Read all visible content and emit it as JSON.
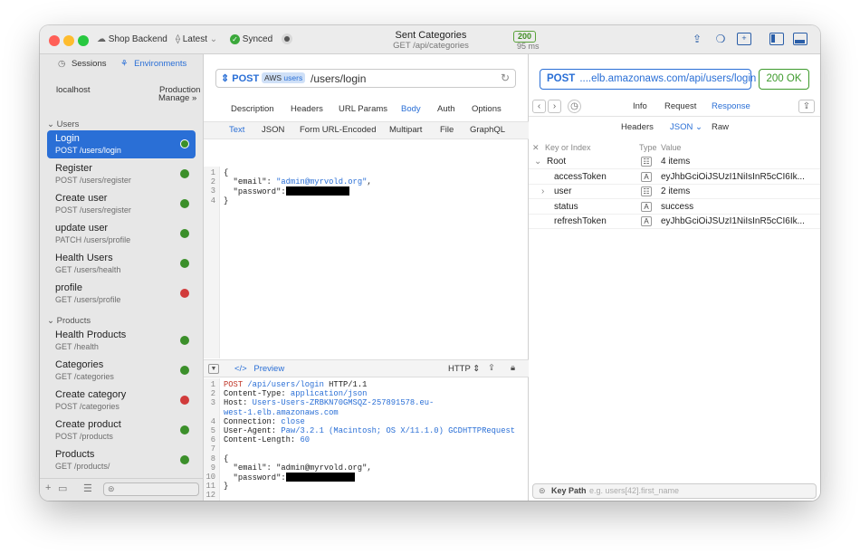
{
  "toolbar": {
    "project": "Shop Backend",
    "version": "Latest",
    "sync": "Synced",
    "title": "Sent Categories",
    "subtitle": "GET /api/categories",
    "status": "200",
    "time": "95 ms"
  },
  "sidebar": {
    "tabs": [
      "Sessions",
      "Environments"
    ],
    "env_left": "localhost",
    "env_right": "Production",
    "manage": "Manage",
    "groups": [
      {
        "label": "Users",
        "items": [
          {
            "name": "Login",
            "sub": "POST /users/login",
            "status": "green"
          },
          {
            "name": "Register",
            "sub": "POST /users/register",
            "status": "green"
          },
          {
            "name": "Create user",
            "sub": "POST /users/register",
            "status": "green"
          },
          {
            "name": "update user",
            "sub": "PATCH /users/profile",
            "status": "green"
          },
          {
            "name": "Health Users",
            "sub": "GET /users/health",
            "status": "green"
          },
          {
            "name": "profile",
            "sub": "GET /users/profile",
            "status": "red"
          }
        ]
      },
      {
        "label": "Products",
        "items": [
          {
            "name": "Health Products",
            "sub": "GET /health",
            "status": "green"
          },
          {
            "name": "Categories",
            "sub": "GET /categories",
            "status": "green"
          },
          {
            "name": "Create category",
            "sub": "POST /categories",
            "status": "red"
          },
          {
            "name": "Create product",
            "sub": "POST /products",
            "status": "green"
          },
          {
            "name": "Products",
            "sub": "GET /products/",
            "status": "green"
          }
        ]
      }
    ]
  },
  "request": {
    "method": "POST",
    "env_tag_a": "AWS",
    "env_tag_b": "users",
    "path": "/users/login",
    "tabs": [
      "Description",
      "Headers",
      "URL Params",
      "Body",
      "Auth",
      "Options"
    ],
    "body_tabs": [
      "Text",
      "JSON",
      "Form URL-Encoded",
      "Multipart",
      "File",
      "GraphQL"
    ],
    "body_lines": [
      "{",
      "\"email\": \"admin@myrvold.org\",",
      "\"password\":",
      "}"
    ],
    "preview_label": "Preview",
    "http_label": "HTTP",
    "http_lines": [
      "POST /api/users/login HTTP/1.1",
      "Content-Type: application/json",
      "Host: Users-Users-ZRBKN70GMSQZ-257891578.eu-",
      "west-1.elb.amazonaws.com",
      "Connection: close",
      "User-Agent: Paw/3.2.1 (Macintosh; OS X/11.1.0) GCDHTTPRequest",
      "Content-Length: 60",
      "",
      "{",
      "\"email\": \"admin@myrvold.org\",",
      "\"password\":",
      "}",
      "",
      ""
    ]
  },
  "response": {
    "method": "POST",
    "url": "....elb.amazonaws.com/api/users/login",
    "status": "200 OK",
    "tabs": [
      "Info",
      "Request",
      "Response"
    ],
    "sub_tabs": [
      "Headers",
      "JSON",
      "Raw"
    ],
    "col_key": "Key or Index",
    "col_type": "Type",
    "col_value": "Value",
    "rows": [
      {
        "key": "Root",
        "type": "obj",
        "value": "4 items"
      },
      {
        "key": "accessToken",
        "type": "A",
        "value": "eyJhbGciOiJSUzI1NiIsInR5cCI6Ik..."
      },
      {
        "key": "user",
        "type": "obj",
        "value": "2 items"
      },
      {
        "key": "status",
        "type": "A",
        "value": "success"
      },
      {
        "key": "refreshToken",
        "type": "A",
        "value": "eyJhbGciOiJSUzI1NiIsInR5cCI6Ik..."
      }
    ],
    "keypath_label": "Key Path",
    "keypath_placeholder": "e.g. users[42].first_name"
  },
  "colors": {
    "accent": "#2a6fd6",
    "green": "#3b8f2a",
    "red": "#d13b3b"
  }
}
